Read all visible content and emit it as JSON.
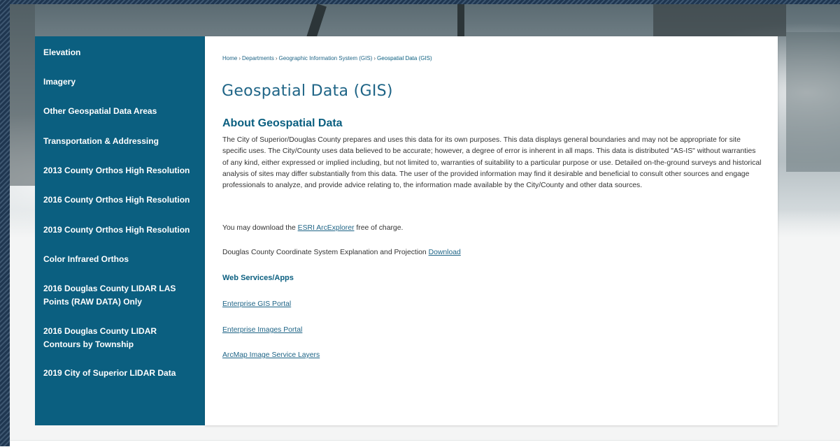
{
  "sidebar": {
    "items": [
      {
        "label": "Elevation"
      },
      {
        "label": "Imagery"
      },
      {
        "label": "Other Geospatial Data Areas"
      },
      {
        "label": "Transportation & Addressing"
      },
      {
        "label": "2013 County Orthos High Resolution"
      },
      {
        "label": "2016 County Orthos High Resolution"
      },
      {
        "label": "2019 County Orthos High Resolution"
      },
      {
        "label": "Color Infrared Orthos"
      },
      {
        "label": "2016 Douglas County LIDAR LAS Points (RAW DATA) Only"
      },
      {
        "label": "2016 Douglas County LIDAR Contours by Township"
      },
      {
        "label": "2019 City of Superior LIDAR Data"
      }
    ]
  },
  "breadcrumb": {
    "items": [
      "Home",
      "Departments",
      "Geographic Information System (GIS)",
      "Geospatial Data (GIS)"
    ],
    "separator": "›"
  },
  "page": {
    "title": "Geospatial Data (GIS)",
    "section_title": "About Geospatial Data",
    "about_paragraph": "The City of Superior/Douglas County prepares and uses this data for its own purposes. This data displays general boundaries and may not be appropriate for site specific uses. The City/County uses data believed to be accurate; however, a degree of error is inherent in all maps. This data is distributed \"AS-IS\" without warranties of any kind, either expressed or implied including, but not limited to, warranties of suitability to a particular purpose or use. Detailed on-the-ground surveys and historical analysis of sites may differ substantially from this data. The user of the provided information may find it desirable and beneficial to consult other sources and engage professionals to analyze, and provide advice relating to, the information made available by the City/County and other data sources.",
    "download_line": {
      "prefix": "You may download the ",
      "link": "ESRI ArcExplorer",
      "suffix": " free of charge."
    },
    "projection_line": {
      "prefix": "Douglas County Coordinate System Explanation and Projection ",
      "link": "Download"
    },
    "web_services_heading": "Web Services/Apps",
    "links": [
      {
        "label": "Enterprise GIS Portal"
      },
      {
        "label": "Enterprise Images Portal"
      },
      {
        "label": "ArcMap Image Service Layers"
      }
    ]
  },
  "colors": {
    "sidebar_bg": "#0b5f80",
    "heading": "#1e6486",
    "body_text": "#333333"
  }
}
